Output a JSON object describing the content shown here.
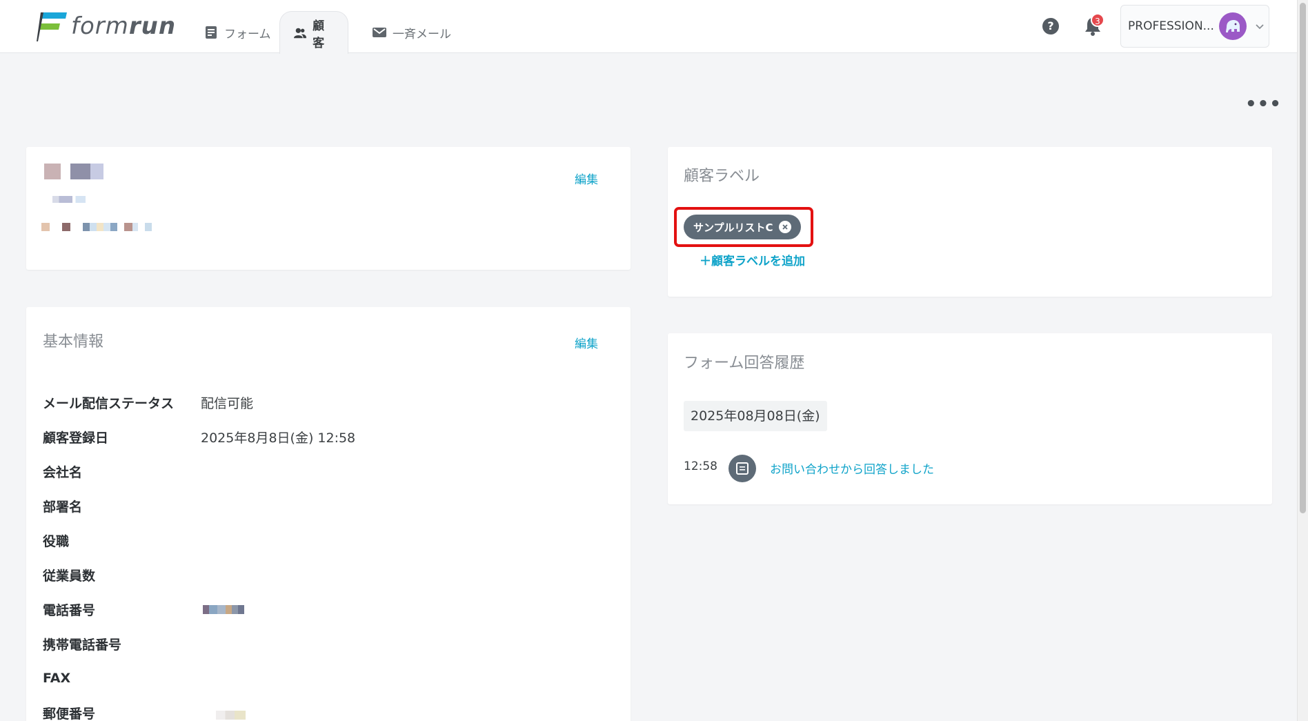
{
  "header": {
    "logo_text_light": "form",
    "logo_text_bold": "run",
    "tabs": [
      {
        "label": "フォーム",
        "icon": "form-icon",
        "active": false
      },
      {
        "label": "顧客",
        "icon": "people-icon",
        "active": true
      },
      {
        "label": "一斉メール",
        "icon": "mail-icon",
        "active": false
      }
    ],
    "help_glyph": "?",
    "notification_count": "3",
    "account_name": "PROFESSION..."
  },
  "more_menu_glyph": "•••",
  "profile_card": {
    "edit_label": "編集"
  },
  "basic_info": {
    "title": "基本情報",
    "edit_label": "編集",
    "rows": [
      {
        "label": "メール配信ステータス",
        "value": "配信可能"
      },
      {
        "label": "顧客登録日",
        "value": "2025年8月8日(金) 12:58"
      },
      {
        "label": "会社名",
        "value": ""
      },
      {
        "label": "部署名",
        "value": ""
      },
      {
        "label": "役職",
        "value": ""
      },
      {
        "label": "従業員数",
        "value": ""
      },
      {
        "label": "電話番号",
        "value": ""
      },
      {
        "label": "携帯電話番号",
        "value": ""
      },
      {
        "label": "FAX",
        "value": ""
      },
      {
        "label": "郵便番号",
        "value": ""
      }
    ]
  },
  "customer_labels": {
    "title": "顧客ラベル",
    "chips": [
      {
        "label": "サンプルリストC"
      }
    ],
    "add_label": "＋顧客ラベルを追加"
  },
  "form_history": {
    "title": "フォーム回答履歴",
    "date": "2025年08月08日(金)",
    "entries": [
      {
        "time": "12:58",
        "text": "お問い合わせから回答しました"
      }
    ]
  },
  "colors": {
    "accent": "#0fa3c9",
    "chip_bg": "#5e6b77",
    "highlight": "#e31111",
    "badge": "#e5484d"
  }
}
